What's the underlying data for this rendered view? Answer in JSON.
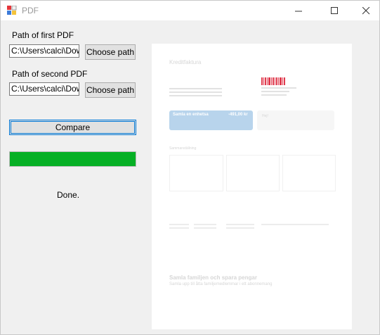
{
  "window": {
    "title": "PDF",
    "controls": {
      "minimize": "minimize-icon",
      "maximize": "maximize-icon",
      "close": "close-icon"
    }
  },
  "form": {
    "first_label": "Path of first PDF",
    "first_path": "C:\\Users\\calci\\Dow",
    "second_label": "Path of second PDF",
    "second_path": "C:\\Users\\calci\\Dow",
    "choose_label": "Choose path",
    "compare_label": "Compare",
    "progress": 1.0,
    "status": "Done."
  },
  "preview": {
    "header": "Kreditfaktura",
    "banner_title": "Samla en enhetsa",
    "banner_amount": "-491,00 kr",
    "side_card_title": "Hej!",
    "section_title": "Sammanställning",
    "promo_title": "Samla familjen och spara pengar",
    "promo_subtitle": "Samla upp till åtta familjemedlemmar i ett abonnemang"
  },
  "colors": {
    "accent": "#0078d7",
    "progress": "#06b025",
    "banner": "#b8d4ec"
  }
}
